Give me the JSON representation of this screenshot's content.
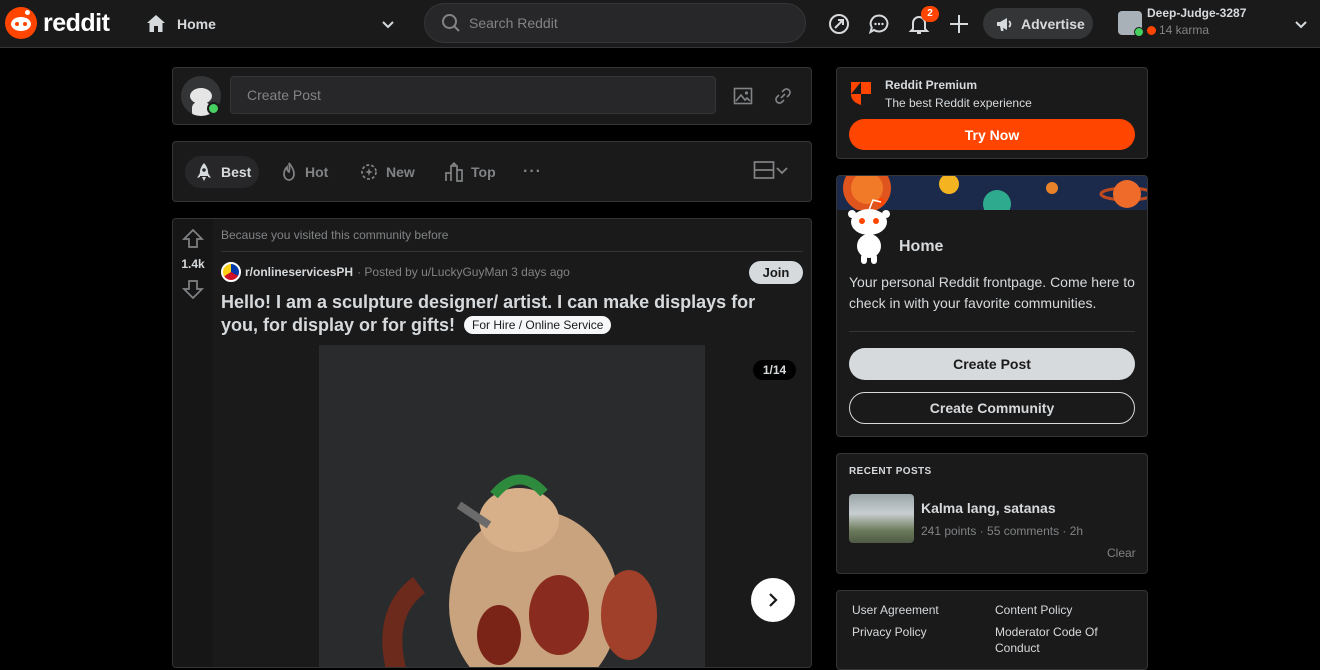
{
  "header": {
    "brand": "reddit",
    "feed_selector": "Home",
    "search_placeholder": "Search Reddit",
    "notification_count": "2",
    "advertise_label": "Advertise",
    "user": {
      "name": "Deep-Judge-3287",
      "karma": "14 karma"
    }
  },
  "create_post": {
    "placeholder": "Create Post"
  },
  "sort": {
    "items": [
      {
        "label": "Best",
        "icon": "rocket-icon",
        "active": true
      },
      {
        "label": "Hot",
        "icon": "flame-icon"
      },
      {
        "label": "New",
        "icon": "sparkle-icon"
      },
      {
        "label": "Top",
        "icon": "top-chart-icon"
      }
    ],
    "more": "···"
  },
  "post": {
    "reason": "Because you visited this community before",
    "score": "1.4k",
    "subreddit": "r/onlineservicesPH",
    "posted_by": "· Posted by u/LuckyGuyMan 3 days ago",
    "join_label": "Join",
    "title": "Hello! I am a sculpture designer/ artist. I can make displays for you, for display or for gifts!",
    "flair": "For Hire / Online Service",
    "gallery_counter": "1/14"
  },
  "premium": {
    "title": "Reddit Premium",
    "subtitle": "The best Reddit experience",
    "button": "Try Now"
  },
  "home_card": {
    "title": "Home",
    "description": "Your personal Reddit frontpage. Come here to check in with your favorite communities.",
    "create_post": "Create Post",
    "create_community": "Create Community"
  },
  "recent_posts": {
    "heading": "RECENT POSTS",
    "items": [
      {
        "title": "Kalma lang, satanas",
        "meta": "241 points · 55 comments · 2h"
      }
    ],
    "clear": "Clear"
  },
  "footer": {
    "links": [
      "User Agreement",
      "Content Policy",
      "Privacy Policy",
      "Moderator Code Of Conduct"
    ]
  },
  "colors": {
    "accent": "#ff4500",
    "background": "#000000",
    "card": "#1a1a1b",
    "border": "#343536",
    "text": "#d7dadc",
    "muted": "#818384",
    "online": "#46d160"
  }
}
